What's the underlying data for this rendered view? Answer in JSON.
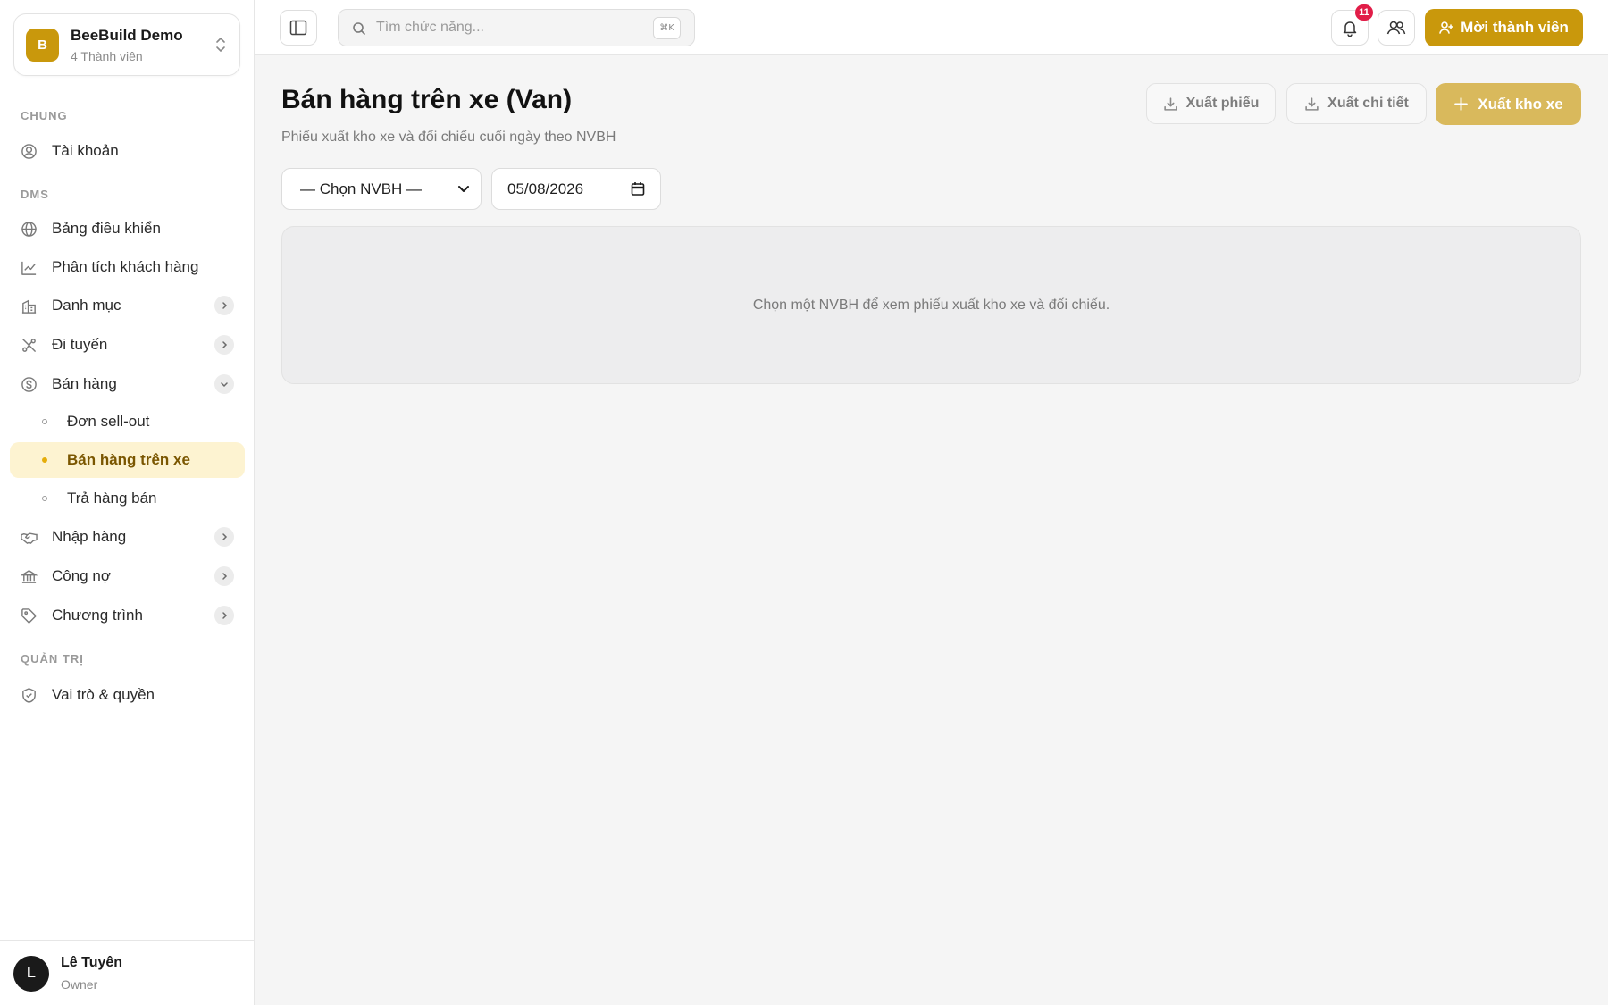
{
  "org": {
    "initial": "B",
    "name": "BeeBuild Demo",
    "members": "4 Thành viên"
  },
  "sections": {
    "general": "CHUNG",
    "dms": "DMS",
    "admin": "QUẢN TRỊ"
  },
  "nav": {
    "account": "Tài khoản",
    "dashboard": "Bảng điều khiển",
    "customer_analytics": "Phân tích khách hàng",
    "catalog": "Danh mục",
    "routing": "Đi tuyến",
    "sales": "Bán hàng",
    "sales_sub": [
      "Đơn sell-out",
      "Bán hàng trên xe",
      "Trả hàng bán"
    ],
    "purchasing": "Nhập hàng",
    "debts": "Công nợ",
    "programs": "Chương trình",
    "roles": "Vai trò & quyền"
  },
  "user": {
    "initial": "L",
    "name": "Lê Tuyên",
    "role": "Owner"
  },
  "topbar": {
    "search_placeholder": "Tìm chức năng...",
    "shortcut": "⌘K",
    "notification_count": "11",
    "invite_label": "Mời thành viên"
  },
  "page": {
    "title": "Bán hàng trên xe (Van)",
    "subtitle": "Phiếu xuất kho xe và đối chiếu cuối ngày theo NVBH",
    "export_slip": "Xuất phiếu",
    "export_detail": "Xuất chi tiết",
    "issue_van_stock": "Xuất kho xe",
    "salesperson_select": "— Chọn NVBH —",
    "date_value": "05/08/2026",
    "empty_message": "Chọn một NVBH để xem phiếu xuất kho xe và đối chiếu."
  },
  "colors": {
    "accent": "#c9980c",
    "accent_soft": "#fdf3d1",
    "badge": "#e11d48"
  }
}
